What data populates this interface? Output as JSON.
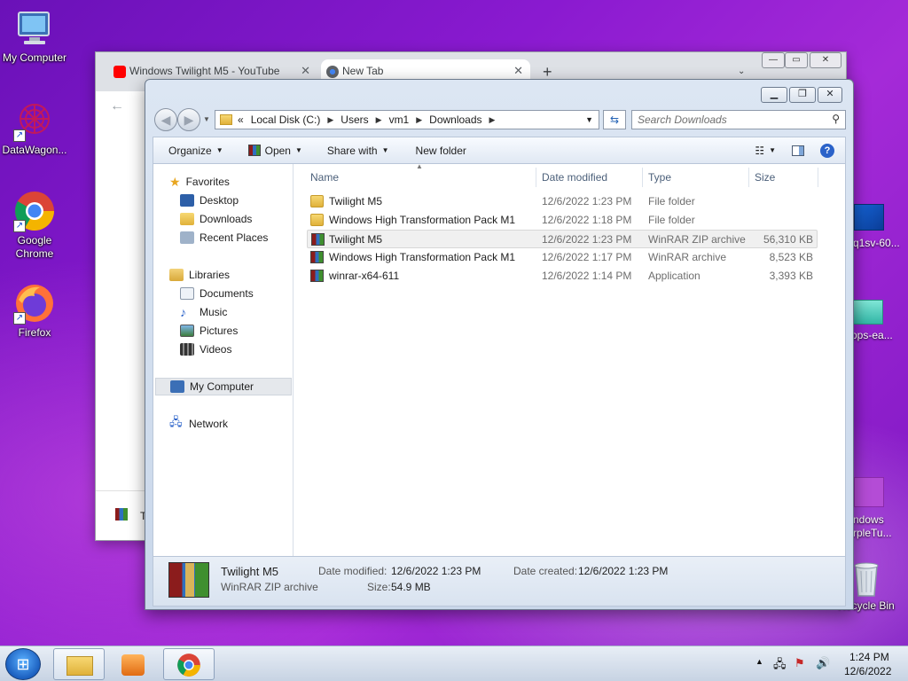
{
  "desktop": {
    "icons": [
      {
        "label": "My Computer"
      },
      {
        "label": "DataWagon..."
      },
      {
        "label": "Google Chrome"
      },
      {
        "label": "Firefox"
      },
      {
        "label": "Recycle Bin"
      }
    ],
    "partial_labels": [
      "q1sv-60...",
      "pps-ea...",
      "ndows",
      "rpleTu..."
    ]
  },
  "chrome": {
    "tabs": [
      {
        "title": "Windows Twilight M5 - YouTube"
      },
      {
        "title": "New Tab"
      }
    ],
    "new_tab_symbol": "+",
    "partial_text": "T"
  },
  "explorer": {
    "breadcrumb": [
      "Local Disk (C:)",
      "Users",
      "vm1",
      "Downloads"
    ],
    "breadcrumb_overflow": "«",
    "search_placeholder": "Search Downloads",
    "toolbar": {
      "organize": "Organize",
      "open": "Open",
      "share_with": "Share with",
      "new_folder": "New folder"
    },
    "nav": {
      "favorites": "Favorites",
      "desktop": "Desktop",
      "downloads": "Downloads",
      "recent_places": "Recent Places",
      "libraries": "Libraries",
      "documents": "Documents",
      "music": "Music",
      "pictures": "Pictures",
      "videos": "Videos",
      "my_computer": "My Computer",
      "network": "Network"
    },
    "columns": {
      "name": "Name",
      "date_modified": "Date modified",
      "type": "Type",
      "size": "Size"
    },
    "files": [
      {
        "name": "Twilight M5",
        "date": "12/6/2022 1:23 PM",
        "type": "File folder",
        "size": "",
        "icon": "folder-icon"
      },
      {
        "name": "Windows High Transformation Pack M1",
        "date": "12/6/2022 1:18 PM",
        "type": "File folder",
        "size": "",
        "icon": "folder-icon"
      },
      {
        "name": "Twilight M5",
        "date": "12/6/2022 1:23 PM",
        "type": "WinRAR ZIP archive",
        "size": "56,310 KB",
        "icon": "winrar-icon"
      },
      {
        "name": "Windows High Transformation Pack M1",
        "date": "12/6/2022 1:17 PM",
        "type": "WinRAR archive",
        "size": "8,523 KB",
        "icon": "winrar-icon"
      },
      {
        "name": "winrar-x64-611",
        "date": "12/6/2022 1:14 PM",
        "type": "Application",
        "size": "3,393 KB",
        "icon": "winrar-icon"
      }
    ],
    "details": {
      "name": "Twilight M5",
      "type": "WinRAR ZIP archive",
      "date_modified_label": "Date modified:",
      "date_modified": "12/6/2022 1:23 PM",
      "size_label": "Size:",
      "size": "54.9 MB",
      "date_created_label": "Date created:",
      "date_created": "12/6/2022 1:23 PM"
    }
  },
  "taskbar": {
    "time": "1:24 PM",
    "date": "12/6/2022"
  }
}
